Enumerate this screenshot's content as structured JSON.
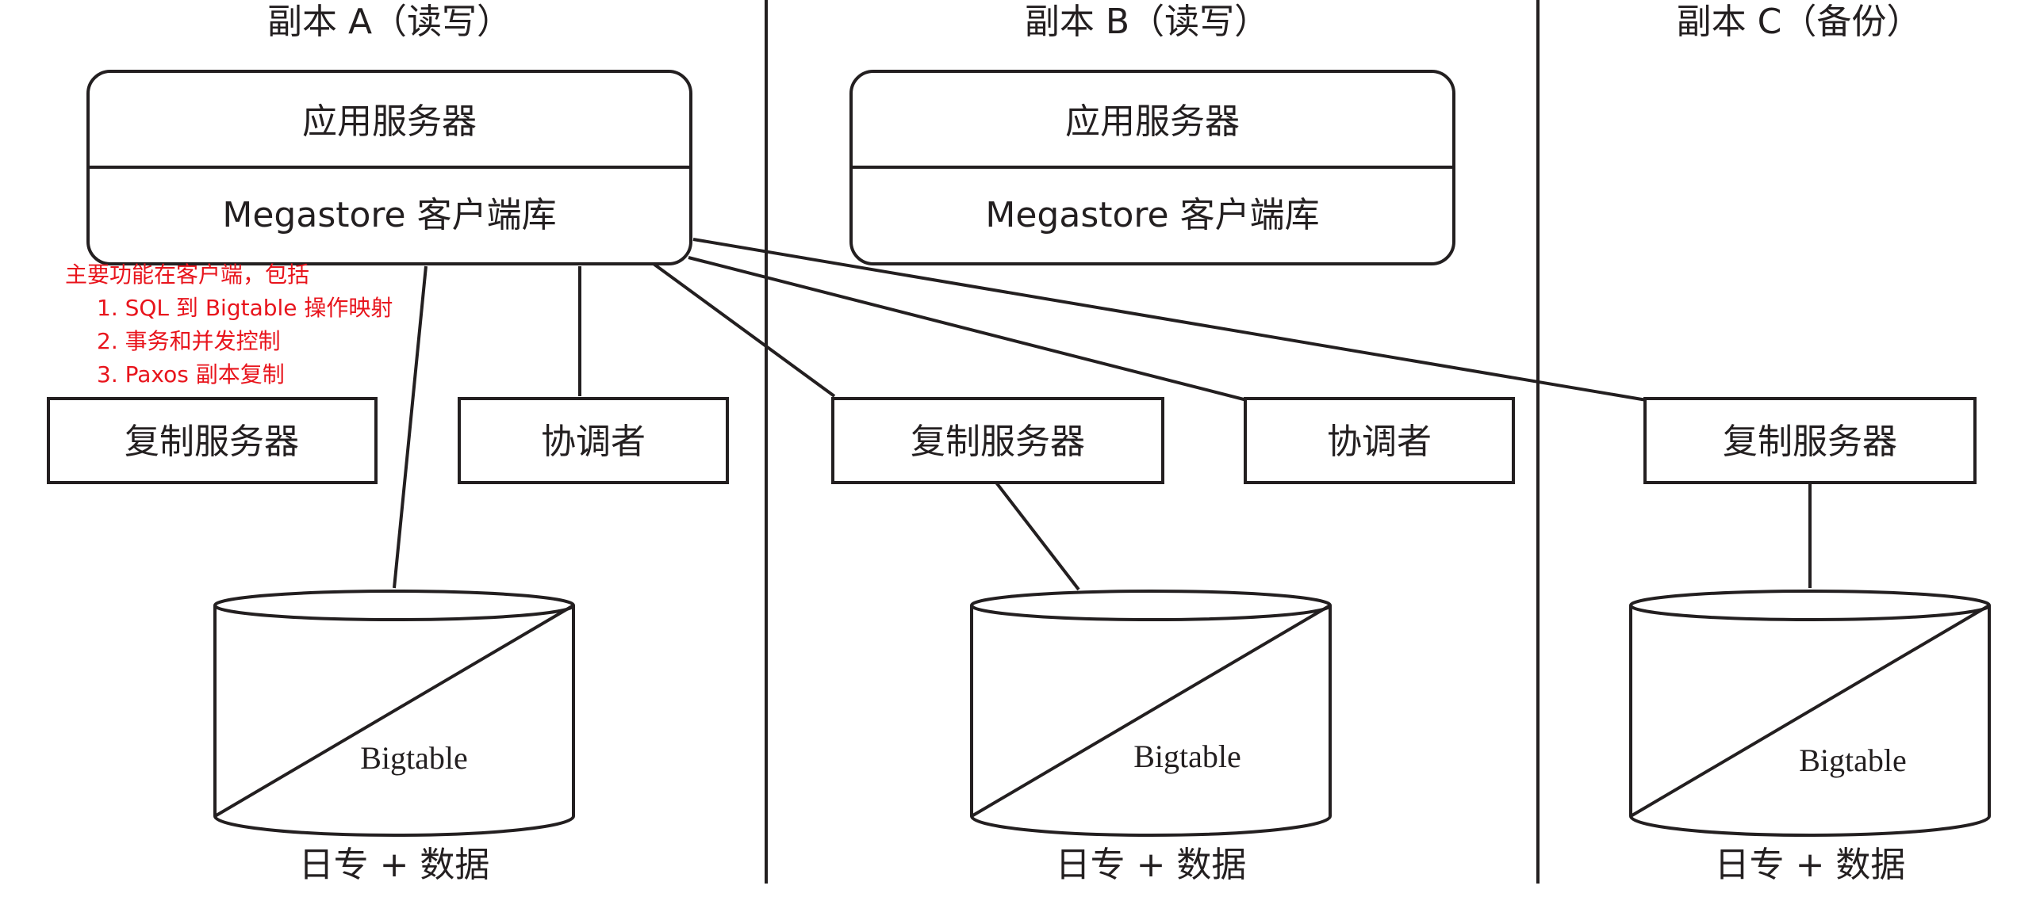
{
  "replicas": [
    {
      "title": "副本 A（读写）",
      "app_server": "应用服务器",
      "client_lib": "Megastore 客户端库",
      "replication_server": "复制服务器",
      "coordinator": "协调者",
      "bigtable": "Bigtable",
      "storage_caption": "日专 + 数据"
    },
    {
      "title": "副本 B（读写）",
      "app_server": "应用服务器",
      "client_lib": "Megastore 客户端库",
      "replication_server": "复制服务器",
      "coordinator": "协调者",
      "bigtable": "Bigtable",
      "storage_caption": "日专 + 数据"
    },
    {
      "title": "副本 C（备份）",
      "replication_server": "复制服务器",
      "bigtable": "Bigtable",
      "storage_caption": "日专 + 数据"
    }
  ],
  "annotation": {
    "heading": "主要功能在客户端，包括",
    "items": [
      "1. SQL 到 Bigtable 操作映射",
      "2. 事务和并发控制",
      "3. Paxos 副本复制"
    ],
    "color": "#e8141c"
  },
  "colors": {
    "line": "#231f20",
    "background": "#ffffff"
  }
}
